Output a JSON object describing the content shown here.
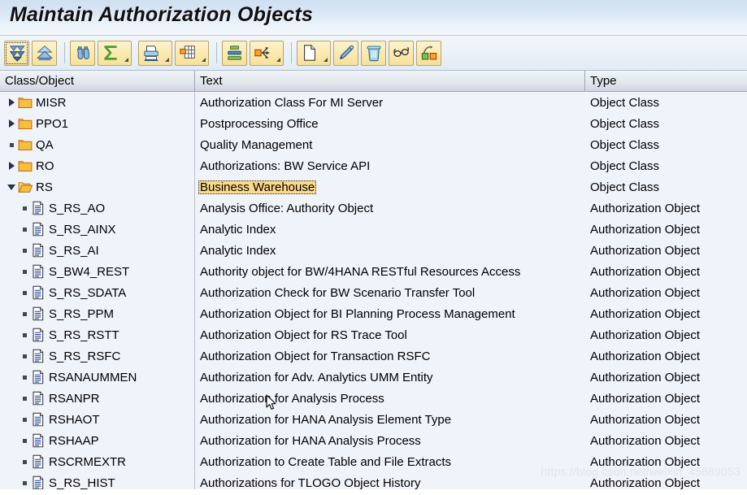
{
  "window": {
    "title": "Maintain Authorization Objects"
  },
  "toolbar": {
    "buttons": [
      {
        "name": "expand-all-button",
        "icon": "expand-all-icon",
        "dropdown": false,
        "focused": true
      },
      {
        "name": "collapse-all-button",
        "icon": "collapse-all-icon",
        "dropdown": false,
        "focused": false
      },
      {
        "name": "find-button",
        "icon": "binoculars-icon",
        "dropdown": false,
        "focused": false
      },
      {
        "name": "total-button",
        "icon": "sigma-icon",
        "dropdown": true,
        "focused": false
      },
      {
        "name": "print-button",
        "icon": "printer-icon",
        "dropdown": true,
        "focused": false
      },
      {
        "name": "layout-button",
        "icon": "table-layout-icon",
        "dropdown": true,
        "focused": false
      },
      {
        "name": "sort-button",
        "icon": "sort-icon",
        "dropdown": false,
        "focused": false
      },
      {
        "name": "expand-node-button",
        "icon": "expand-arrows-icon",
        "dropdown": true,
        "focused": false
      },
      {
        "name": "create-button",
        "icon": "new-document-icon",
        "dropdown": true,
        "focused": false
      },
      {
        "name": "change-button",
        "icon": "pencil-icon",
        "dropdown": false,
        "focused": false
      },
      {
        "name": "delete-button",
        "icon": "trash-icon",
        "dropdown": false,
        "focused": false
      },
      {
        "name": "display-button",
        "icon": "glasses-icon",
        "dropdown": false,
        "focused": false
      },
      {
        "name": "transport-button",
        "icon": "transport-icon",
        "dropdown": false,
        "focused": false
      }
    ]
  },
  "grid": {
    "columns": [
      {
        "key": "class_object",
        "label": "Class/Object"
      },
      {
        "key": "text",
        "label": "Text"
      },
      {
        "key": "type",
        "label": "Type"
      }
    ],
    "rows": [
      {
        "name": "MISR",
        "text": "Authorization Class For MI Server",
        "type": "Object Class",
        "level": 0,
        "node": "folder-closed-icon",
        "twisty": "right",
        "highlight": false
      },
      {
        "name": "PPO1",
        "text": "Postprocessing Office",
        "type": "Object Class",
        "level": 0,
        "node": "folder-closed-icon",
        "twisty": "right",
        "highlight": false
      },
      {
        "name": "QA",
        "text": "Quality Management",
        "type": "Object Class",
        "level": 0,
        "node": "folder-closed-icon",
        "twisty": "dot",
        "highlight": false
      },
      {
        "name": "RO",
        "text": "Authorizations: BW Service API",
        "type": "Object Class",
        "level": 0,
        "node": "folder-closed-icon",
        "twisty": "right",
        "highlight": false
      },
      {
        "name": "RS",
        "text": "Business Warehouse",
        "type": "Object Class",
        "level": 0,
        "node": "folder-open-icon",
        "twisty": "down",
        "highlight": true
      },
      {
        "name": "S_RS_AO",
        "text": "Analysis Office: Authority Object",
        "type": "Authorization Object",
        "level": 1,
        "node": "document-icon",
        "twisty": "dot",
        "highlight": false
      },
      {
        "name": "S_RS_AINX",
        "text": "Analytic Index",
        "type": "Authorization Object",
        "level": 1,
        "node": "document-icon",
        "twisty": "dot",
        "highlight": false
      },
      {
        "name": "S_RS_AI",
        "text": "Analytic Index",
        "type": "Authorization Object",
        "level": 1,
        "node": "document-icon",
        "twisty": "dot",
        "highlight": false
      },
      {
        "name": "S_BW4_REST",
        "text": "Authority object for BW/4HANA RESTful Resources Access",
        "type": "Authorization Object",
        "level": 1,
        "node": "document-icon",
        "twisty": "dot",
        "highlight": false
      },
      {
        "name": "S_RS_SDATA",
        "text": "Authorization Check for BW Scenario Transfer Tool",
        "type": "Authorization Object",
        "level": 1,
        "node": "document-icon",
        "twisty": "dot",
        "highlight": false
      },
      {
        "name": "S_RS_PPM",
        "text": "Authorization Object for BI Planning Process Management",
        "type": "Authorization Object",
        "level": 1,
        "node": "document-icon",
        "twisty": "dot",
        "highlight": false
      },
      {
        "name": "S_RS_RSTT",
        "text": "Authorization Object for RS Trace Tool",
        "type": "Authorization Object",
        "level": 1,
        "node": "document-icon",
        "twisty": "dot",
        "highlight": false
      },
      {
        "name": "S_RS_RSFC",
        "text": "Authorization Object for Transaction RSFC",
        "type": "Authorization Object",
        "level": 1,
        "node": "document-icon",
        "twisty": "dot",
        "highlight": false
      },
      {
        "name": "RSANAUMMEN",
        "text": "Authorization for Adv. Analytics UMM Entity",
        "type": "Authorization Object",
        "level": 1,
        "node": "document-icon",
        "twisty": "dot",
        "highlight": false
      },
      {
        "name": "RSANPR",
        "text": "Authorization for Analysis Process",
        "type": "Authorization Object",
        "level": 1,
        "node": "document-icon",
        "twisty": "dot",
        "highlight": false
      },
      {
        "name": "RSHAOT",
        "text": "Authorization for HANA Analysis Element Type",
        "type": "Authorization Object",
        "level": 1,
        "node": "document-icon",
        "twisty": "dot",
        "highlight": false
      },
      {
        "name": "RSHAAP",
        "text": "Authorization for HANA Analysis Process",
        "type": "Authorization Object",
        "level": 1,
        "node": "document-icon",
        "twisty": "dot",
        "highlight": false
      },
      {
        "name": "RSCRMEXTR",
        "text": "Authorization to Create Table and File Extracts",
        "type": "Authorization Object",
        "level": 1,
        "node": "document-icon",
        "twisty": "dot",
        "highlight": false
      },
      {
        "name": "S_RS_HIST",
        "text": "Authorizations for TLOGO Object History",
        "type": "Authorization Object",
        "level": 1,
        "node": "document-icon",
        "twisty": "dot",
        "highlight": false
      }
    ]
  },
  "watermark": {
    "text": "https://blog.csdn.net/weixin_45689053"
  },
  "colors": {
    "title_bar_top": "#cfe0f2",
    "toolbar_button": "#fbeab0",
    "grid_background": "#eff3fa",
    "highlight_cell": "#fbd98a",
    "folder": "#f5b72b",
    "header_bottom": "#cfd6e0"
  }
}
